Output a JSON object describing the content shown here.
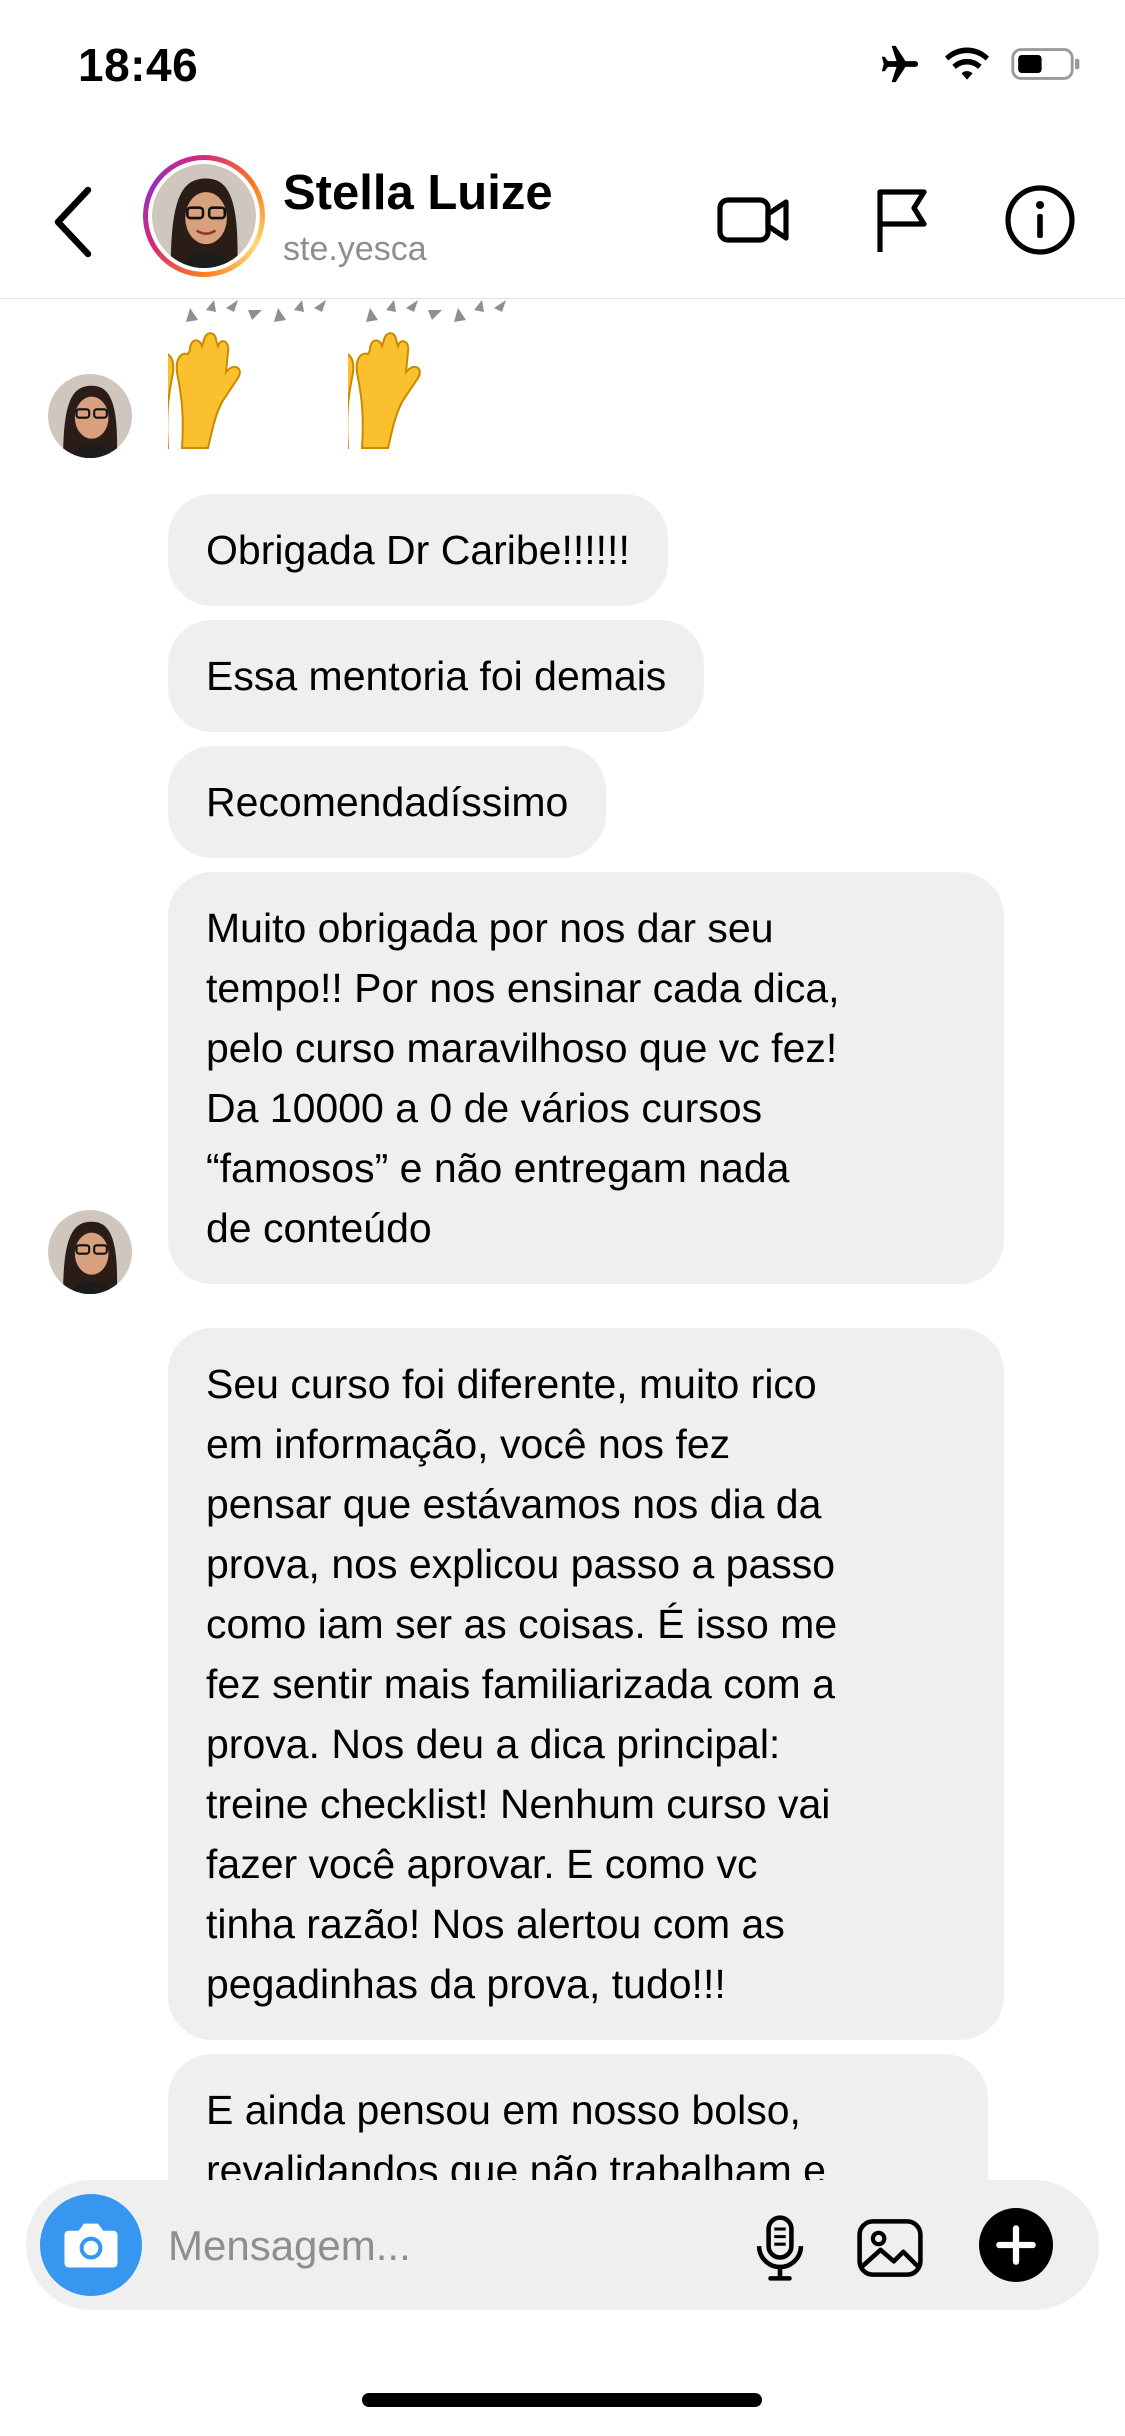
{
  "status_bar": {
    "time": "18:46",
    "icons": [
      "airplane-icon",
      "wifi-icon",
      "battery-icon"
    ]
  },
  "header": {
    "contact_name": "Stella Luize",
    "username": "ste.yesca",
    "icons": [
      "back-chevron-icon",
      "video-call-icon",
      "flag-icon",
      "info-icon"
    ]
  },
  "thread": {
    "reaction_emoji": "🙌🙌",
    "messages": [
      {
        "text": "Obrigada Dr Caribe!!!!!!"
      },
      {
        "text": "Essa mentoria foi demais"
      },
      {
        "text": "Recomendadíssimo"
      },
      {
        "text": "Muito obrigada por nos dar seu\ntempo!! Por nos ensinar cada dica,\npelo curso maravilhoso que vc fez!\nDa 10000 a 0 de vários cursos\n“famosos” e não entregam nada\nde conteúdo"
      },
      {
        "text": "Seu curso foi diferente, muito rico\nem informação, você nos fez\npensar que estávamos nos dia da\nprova, nos explicou passo a passo\ncomo iam ser as coisas. É isso me\nfez sentir mais familiarizada com a\nprova. Nos deu a dica principal:\ntreine checklist! Nenhum curso vai\nfazer você aprovar. E como vc\ntinha razão! Nos alertou com as\npegadinhas da prova, tudo!!!"
      },
      {
        "text": "E ainda pensou em nosso bolso,\nrevalidandos que não trabalham e"
      }
    ]
  },
  "composer": {
    "placeholder": "Mensagem...",
    "value": "",
    "icons": [
      "camera-icon",
      "microphone-icon",
      "gallery-icon",
      "plus-icon"
    ]
  },
  "colors": {
    "bubble_bg": "#efefef",
    "camera_button": "#3797f0",
    "secondary_text": "#8e8e8e",
    "avatar_ring": [
      "#d62976",
      "#fa7e1e",
      "#feda75"
    ]
  }
}
